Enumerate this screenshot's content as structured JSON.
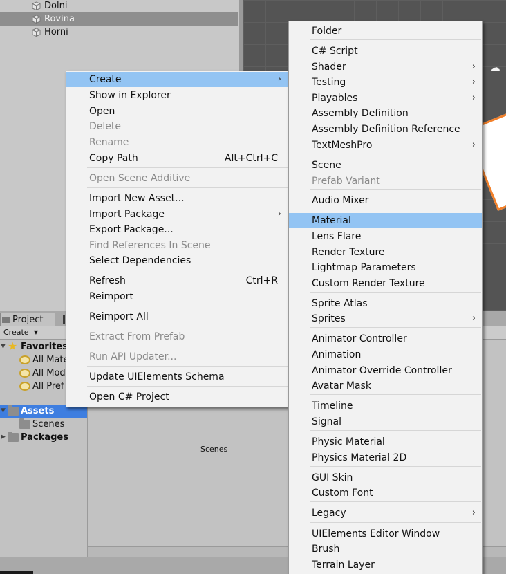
{
  "hierarchy": {
    "items": [
      {
        "label": "Dolni",
        "selected": false
      },
      {
        "label": "Rovina",
        "selected": true
      },
      {
        "label": "Horni",
        "selected": false
      }
    ]
  },
  "project": {
    "tab_label": "Project",
    "create_label": "Create",
    "tree": [
      {
        "label": "Favorites",
        "icon": "star-icon",
        "bold": true,
        "expanded": true
      },
      {
        "label": "All Mate",
        "icon": "search-icon"
      },
      {
        "label": "All Mod",
        "icon": "search-icon"
      },
      {
        "label": "All Pref",
        "icon": "search-icon"
      },
      {
        "label": "Assets",
        "icon": "folder-icon",
        "bold": true,
        "selected": true,
        "expanded": true
      },
      {
        "label": "Scenes",
        "icon": "folder-icon"
      },
      {
        "label": "Packages",
        "icon": "folder-icon",
        "bold": true,
        "expanded": false
      }
    ],
    "content_items": [
      "Scenes"
    ]
  },
  "context_menu": {
    "items": [
      {
        "label": "Create",
        "submenu": true,
        "highlighted": true
      },
      {
        "label": "Show in Explorer"
      },
      {
        "label": "Open"
      },
      {
        "label": "Delete",
        "disabled": true
      },
      {
        "label": "Rename",
        "disabled": true
      },
      {
        "label": "Copy Path",
        "shortcut": "Alt+Ctrl+C"
      },
      {
        "label": "Open Scene Additive",
        "disabled": true
      },
      {
        "label": "Import New Asset..."
      },
      {
        "label": "Import Package",
        "submenu": true
      },
      {
        "label": "Export Package..."
      },
      {
        "label": "Find References In Scene",
        "disabled": true
      },
      {
        "label": "Select Dependencies"
      },
      {
        "label": "Refresh",
        "shortcut": "Ctrl+R"
      },
      {
        "label": "Reimport"
      },
      {
        "label": "Reimport All"
      },
      {
        "label": "Extract From Prefab",
        "disabled": true
      },
      {
        "label": "Run API Updater...",
        "disabled": true
      },
      {
        "label": "Update UIElements Schema"
      },
      {
        "label": "Open C# Project"
      }
    ]
  },
  "create_submenu": {
    "items": [
      {
        "label": "Folder"
      },
      {
        "label": "C# Script"
      },
      {
        "label": "Shader",
        "submenu": true
      },
      {
        "label": "Testing",
        "submenu": true
      },
      {
        "label": "Playables",
        "submenu": true
      },
      {
        "label": "Assembly Definition"
      },
      {
        "label": "Assembly Definition Reference"
      },
      {
        "label": "TextMeshPro",
        "submenu": true
      },
      {
        "label": "Scene"
      },
      {
        "label": "Prefab Variant",
        "disabled": true
      },
      {
        "label": "Audio Mixer"
      },
      {
        "label": "Material",
        "highlighted": true
      },
      {
        "label": "Lens Flare"
      },
      {
        "label": "Render Texture"
      },
      {
        "label": "Lightmap Parameters"
      },
      {
        "label": "Custom Render Texture"
      },
      {
        "label": "Sprite Atlas"
      },
      {
        "label": "Sprites",
        "submenu": true
      },
      {
        "label": "Animator Controller"
      },
      {
        "label": "Animation"
      },
      {
        "label": "Animator Override Controller"
      },
      {
        "label": "Avatar Mask"
      },
      {
        "label": "Timeline"
      },
      {
        "label": "Signal"
      },
      {
        "label": "Physic Material"
      },
      {
        "label": "Physics Material 2D"
      },
      {
        "label": "GUI Skin"
      },
      {
        "label": "Custom Font"
      },
      {
        "label": "Legacy",
        "submenu": true
      },
      {
        "label": "UIElements Editor Window"
      },
      {
        "label": "Brush"
      },
      {
        "label": "Terrain Layer"
      }
    ]
  },
  "colors": {
    "menu_highlight": "#93c4f3",
    "tree_selection": "#3e7ee0",
    "disabled_text": "#8a8a8a"
  }
}
